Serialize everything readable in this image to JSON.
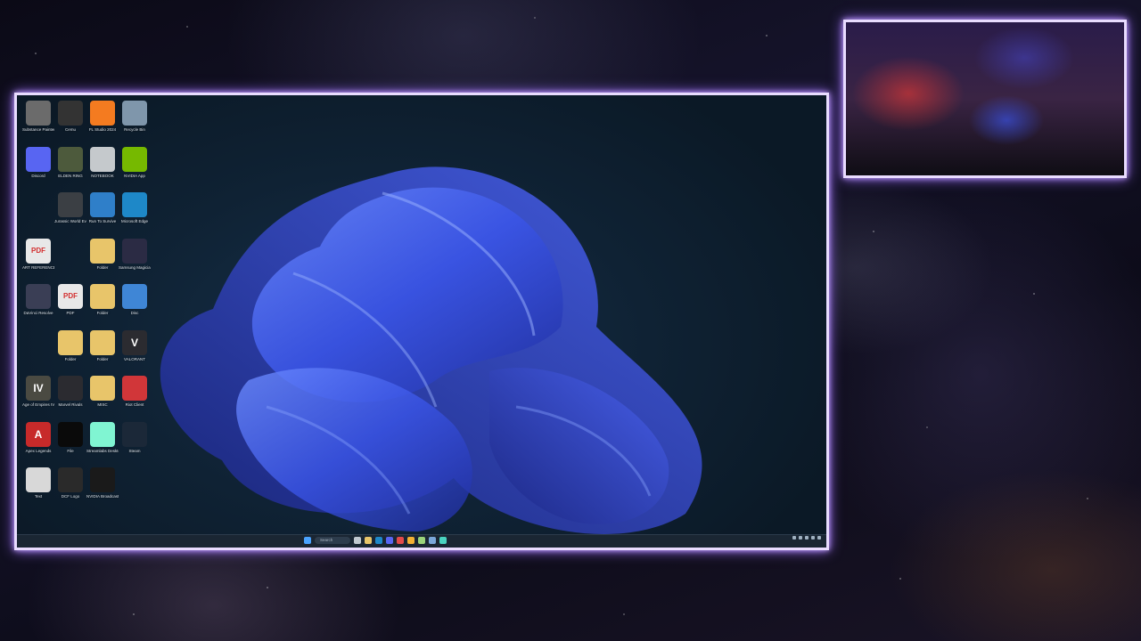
{
  "desktop": {
    "icons": [
      {
        "name": "Substance Painter",
        "label": "Substance Painter",
        "color": "#6b6b6b",
        "glyph": "",
        "col": 0,
        "row": 0
      },
      {
        "name": "Cemu",
        "label": "Cemu",
        "color": "#333333",
        "glyph": "",
        "col": 1,
        "row": 0
      },
      {
        "name": "FL Studio",
        "label": "FL Studio 2024",
        "color": "#f47b20",
        "glyph": "",
        "col": 2,
        "row": 0
      },
      {
        "name": "Recycle Bin",
        "label": "Recycle Bin",
        "color": "#7f96ab",
        "glyph": "",
        "col": 3,
        "row": 0
      },
      {
        "name": "Discord",
        "label": "Discord",
        "color": "#5865f2",
        "glyph": "",
        "col": 0,
        "row": 1
      },
      {
        "name": "Elden Ring",
        "label": "ELDEN RING",
        "color": "#4d5a3c",
        "glyph": "",
        "col": 1,
        "row": 1
      },
      {
        "name": "Document",
        "label": "NOTEBOOK",
        "color": "#c5c9cc",
        "glyph": "",
        "col": 2,
        "row": 1
      },
      {
        "name": "NVIDIA App",
        "label": "NVIDIA App",
        "color": "#76b900",
        "glyph": "",
        "col": 3,
        "row": 1
      },
      {
        "name": "Jurassic World Evolution",
        "label": "Jurassic World Evolution",
        "color": "#3b3f44",
        "glyph": "",
        "col": 1,
        "row": 2
      },
      {
        "name": "Run To Survive",
        "label": "Run To Survive",
        "color": "#2f7fc9",
        "glyph": "",
        "col": 2,
        "row": 2
      },
      {
        "name": "Microsoft Edge",
        "label": "Microsoft Edge",
        "color": "#1e88c8",
        "glyph": "",
        "col": 3,
        "row": 2
      },
      {
        "name": "PDF document",
        "label": "ART REFERENCE",
        "color": "#e8e8e8",
        "glyph": "PDF",
        "col": 0,
        "row": 3
      },
      {
        "name": "Folder",
        "label": "Folder",
        "color": "#e8c56a",
        "glyph": "",
        "col": 2,
        "row": 3
      },
      {
        "name": "Samsung Magician",
        "label": "Samsung Magician",
        "color": "#2b2b44",
        "glyph": "",
        "col": 3,
        "row": 3
      },
      {
        "name": "DaVinci Resolve",
        "label": "DaVinci Resolve",
        "color": "#3a3e55",
        "glyph": "",
        "col": 0,
        "row": 4
      },
      {
        "name": "PDF document 2",
        "label": "PDF",
        "color": "#e8e8e8",
        "glyph": "PDF",
        "col": 1,
        "row": 4
      },
      {
        "name": "Folder 2",
        "label": "Folder",
        "color": "#e8c56a",
        "glyph": "",
        "col": 2,
        "row": 4
      },
      {
        "name": "Disc app",
        "label": "Disc",
        "color": "#3f86d6",
        "glyph": "",
        "col": 3,
        "row": 4
      },
      {
        "name": "Folder 3",
        "label": "Folder",
        "color": "#e8c56a",
        "glyph": "",
        "col": 1,
        "row": 5
      },
      {
        "name": "Folder 4",
        "label": "Folder",
        "color": "#e8c56a",
        "glyph": "",
        "col": 2,
        "row": 5
      },
      {
        "name": "Valorant",
        "label": "VALORANT",
        "color": "#2b2b30",
        "glyph": "V",
        "col": 3,
        "row": 5
      },
      {
        "name": "Age of Empires IV",
        "label": "Age of Empires IV",
        "color": "#4a4a42",
        "glyph": "IV",
        "col": 0,
        "row": 6
      },
      {
        "name": "Marvel Rivals",
        "label": "Marvel Rivals",
        "color": "#2b2b30",
        "glyph": "",
        "col": 1,
        "row": 6
      },
      {
        "name": "Folder 5",
        "label": "MISC",
        "color": "#e8c56a",
        "glyph": "",
        "col": 2,
        "row": 6
      },
      {
        "name": "Riot Client",
        "label": "Riot Client",
        "color": "#d13639",
        "glyph": "",
        "col": 3,
        "row": 6
      },
      {
        "name": "Apex Legends",
        "label": "Apex Legends",
        "color": "#c72a2a",
        "glyph": "A",
        "col": 0,
        "row": 7
      },
      {
        "name": "Black file",
        "label": "File",
        "color": "#0a0a0a",
        "glyph": "",
        "col": 1,
        "row": 7
      },
      {
        "name": "Streamlabs Desktop",
        "label": "Streamlabs Desktop",
        "color": "#80f5d2",
        "glyph": "",
        "col": 2,
        "row": 7
      },
      {
        "name": "Steam",
        "label": "Steam",
        "color": "#1b2838",
        "glyph": "",
        "col": 3,
        "row": 7
      },
      {
        "name": "Text document",
        "label": "Text",
        "color": "#d8d8d8",
        "glyph": "",
        "col": 0,
        "row": 8
      },
      {
        "name": "DCF Logo",
        "label": "DCF Logo",
        "color": "#2a2a2a",
        "glyph": "",
        "col": 1,
        "row": 8
      },
      {
        "name": "NVIDIA Broadcast",
        "label": "NVIDIA Broadcast",
        "color": "#1a1a1a",
        "glyph": "",
        "col": 2,
        "row": 8
      }
    ]
  },
  "taskbar": {
    "search_label": "Search",
    "weather_temp": "",
    "weather_desc": ""
  },
  "colors": {
    "frame_glow": "#9b6bff",
    "frame_edge": "#e9dcff",
    "taskbar": "#1a2633",
    "bloom": "#3f5cf0"
  }
}
